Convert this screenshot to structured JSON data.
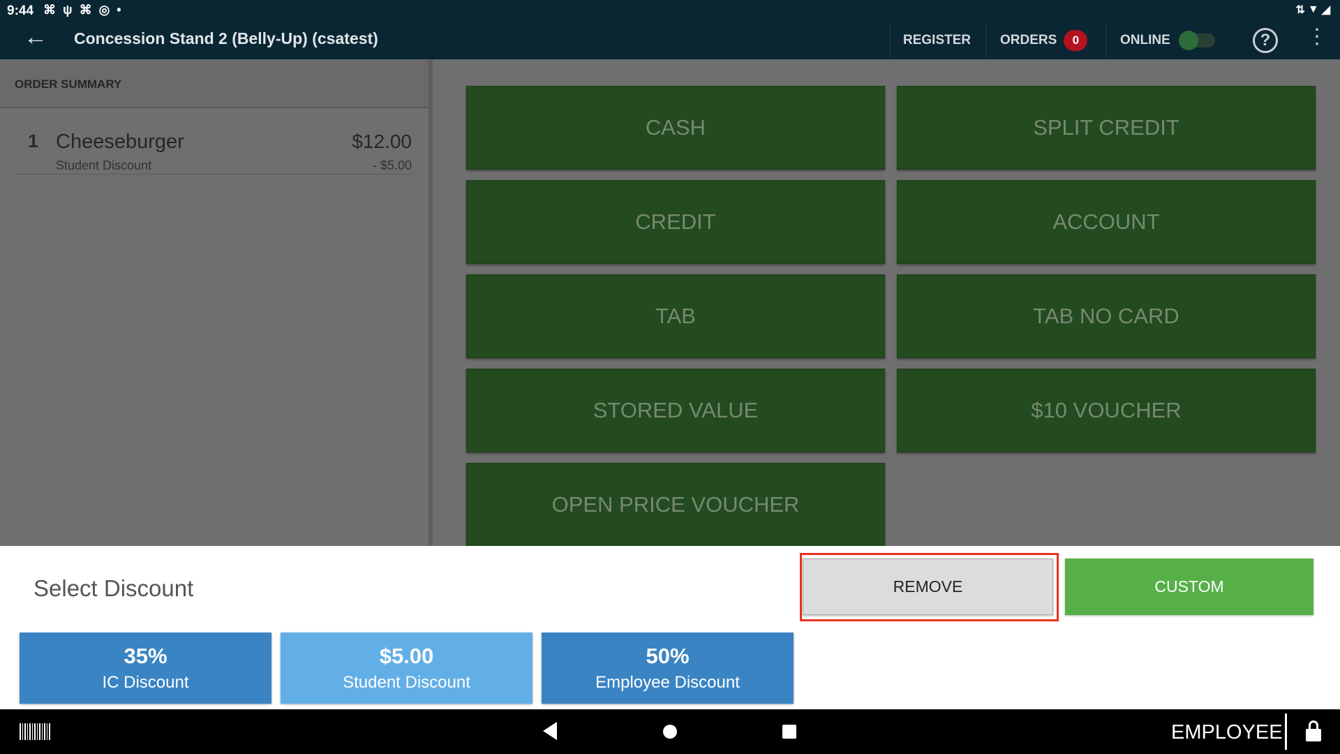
{
  "status_bar": {
    "time": "9:44"
  },
  "app_bar": {
    "back_glyph": "←",
    "title": "Concession Stand 2 (Belly-Up) (csatest)",
    "register_label": "REGISTER",
    "orders_label": "ORDERS",
    "orders_count": "0",
    "online_label": "ONLINE",
    "help_glyph": "?",
    "menu_glyph": "⋮"
  },
  "order_summary": {
    "header": "ORDER SUMMARY",
    "items": [
      {
        "qty": "1",
        "name": "Cheeseburger",
        "price": "$12.00",
        "discount_name": "Student Discount",
        "discount_amount": "- $5.00"
      }
    ]
  },
  "payment_methods": [
    "CASH",
    "SPLIT CREDIT",
    "CREDIT",
    "ACCOUNT",
    "TAB",
    "TAB NO CARD",
    "STORED VALUE",
    "$10 VOUCHER",
    "OPEN PRICE VOUCHER"
  ],
  "discount_sheet": {
    "title": "Select Discount",
    "remove_label": "REMOVE",
    "custom_label": "CUSTOM",
    "discounts": [
      {
        "amount": "35%",
        "label": "IC Discount",
        "color": "#3a84c4"
      },
      {
        "amount": "$5.00",
        "label": "Student Discount",
        "color": "#62aee6"
      },
      {
        "amount": "50%",
        "label": "Employee Discount",
        "color": "#3a84c4"
      }
    ]
  },
  "nav_bar": {
    "user_label": "EMPLOYEE"
  },
  "colors": {
    "app_bar": "#0b2633",
    "payment_button": "#244a1f",
    "custom_button": "#56b047",
    "highlight": "#e8321f",
    "orders_badge": "#b3121f"
  }
}
